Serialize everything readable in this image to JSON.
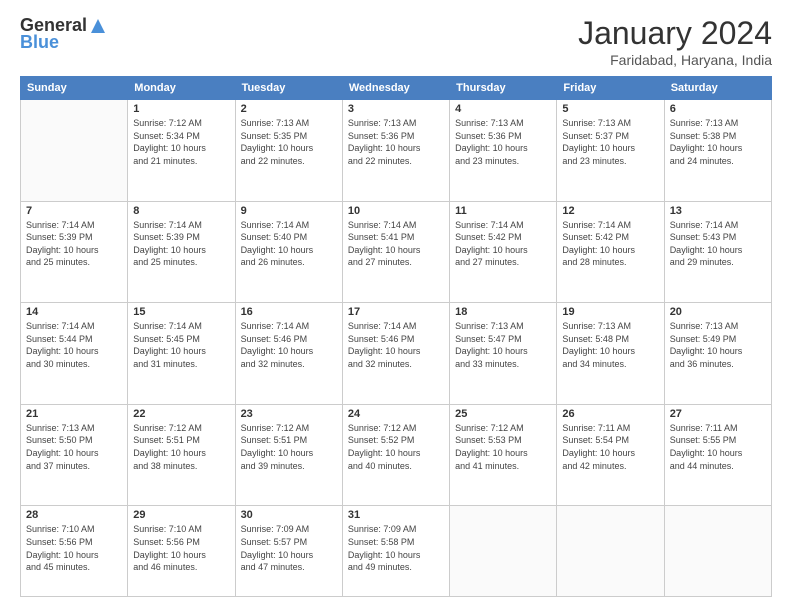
{
  "logo": {
    "line1": "General",
    "line2": "Blue"
  },
  "title": "January 2024",
  "location": "Faridabad, Haryana, India",
  "days_of_week": [
    "Sunday",
    "Monday",
    "Tuesday",
    "Wednesday",
    "Thursday",
    "Friday",
    "Saturday"
  ],
  "weeks": [
    [
      {
        "day": "",
        "sunrise": "",
        "sunset": "",
        "daylight": ""
      },
      {
        "day": "1",
        "sunrise": "Sunrise: 7:12 AM",
        "sunset": "Sunset: 5:34 PM",
        "daylight": "Daylight: 10 hours and 21 minutes."
      },
      {
        "day": "2",
        "sunrise": "Sunrise: 7:13 AM",
        "sunset": "Sunset: 5:35 PM",
        "daylight": "Daylight: 10 hours and 22 minutes."
      },
      {
        "day": "3",
        "sunrise": "Sunrise: 7:13 AM",
        "sunset": "Sunset: 5:36 PM",
        "daylight": "Daylight: 10 hours and 22 minutes."
      },
      {
        "day": "4",
        "sunrise": "Sunrise: 7:13 AM",
        "sunset": "Sunset: 5:36 PM",
        "daylight": "Daylight: 10 hours and 23 minutes."
      },
      {
        "day": "5",
        "sunrise": "Sunrise: 7:13 AM",
        "sunset": "Sunset: 5:37 PM",
        "daylight": "Daylight: 10 hours and 23 minutes."
      },
      {
        "day": "6",
        "sunrise": "Sunrise: 7:13 AM",
        "sunset": "Sunset: 5:38 PM",
        "daylight": "Daylight: 10 hours and 24 minutes."
      }
    ],
    [
      {
        "day": "7",
        "sunrise": "Sunrise: 7:14 AM",
        "sunset": "Sunset: 5:39 PM",
        "daylight": "Daylight: 10 hours and 25 minutes."
      },
      {
        "day": "8",
        "sunrise": "Sunrise: 7:14 AM",
        "sunset": "Sunset: 5:39 PM",
        "daylight": "Daylight: 10 hours and 25 minutes."
      },
      {
        "day": "9",
        "sunrise": "Sunrise: 7:14 AM",
        "sunset": "Sunset: 5:40 PM",
        "daylight": "Daylight: 10 hours and 26 minutes."
      },
      {
        "day": "10",
        "sunrise": "Sunrise: 7:14 AM",
        "sunset": "Sunset: 5:41 PM",
        "daylight": "Daylight: 10 hours and 27 minutes."
      },
      {
        "day": "11",
        "sunrise": "Sunrise: 7:14 AM",
        "sunset": "Sunset: 5:42 PM",
        "daylight": "Daylight: 10 hours and 27 minutes."
      },
      {
        "day": "12",
        "sunrise": "Sunrise: 7:14 AM",
        "sunset": "Sunset: 5:42 PM",
        "daylight": "Daylight: 10 hours and 28 minutes."
      },
      {
        "day": "13",
        "sunrise": "Sunrise: 7:14 AM",
        "sunset": "Sunset: 5:43 PM",
        "daylight": "Daylight: 10 hours and 29 minutes."
      }
    ],
    [
      {
        "day": "14",
        "sunrise": "Sunrise: 7:14 AM",
        "sunset": "Sunset: 5:44 PM",
        "daylight": "Daylight: 10 hours and 30 minutes."
      },
      {
        "day": "15",
        "sunrise": "Sunrise: 7:14 AM",
        "sunset": "Sunset: 5:45 PM",
        "daylight": "Daylight: 10 hours and 31 minutes."
      },
      {
        "day": "16",
        "sunrise": "Sunrise: 7:14 AM",
        "sunset": "Sunset: 5:46 PM",
        "daylight": "Daylight: 10 hours and 32 minutes."
      },
      {
        "day": "17",
        "sunrise": "Sunrise: 7:14 AM",
        "sunset": "Sunset: 5:46 PM",
        "daylight": "Daylight: 10 hours and 32 minutes."
      },
      {
        "day": "18",
        "sunrise": "Sunrise: 7:13 AM",
        "sunset": "Sunset: 5:47 PM",
        "daylight": "Daylight: 10 hours and 33 minutes."
      },
      {
        "day": "19",
        "sunrise": "Sunrise: 7:13 AM",
        "sunset": "Sunset: 5:48 PM",
        "daylight": "Daylight: 10 hours and 34 minutes."
      },
      {
        "day": "20",
        "sunrise": "Sunrise: 7:13 AM",
        "sunset": "Sunset: 5:49 PM",
        "daylight": "Daylight: 10 hours and 36 minutes."
      }
    ],
    [
      {
        "day": "21",
        "sunrise": "Sunrise: 7:13 AM",
        "sunset": "Sunset: 5:50 PM",
        "daylight": "Daylight: 10 hours and 37 minutes."
      },
      {
        "day": "22",
        "sunrise": "Sunrise: 7:12 AM",
        "sunset": "Sunset: 5:51 PM",
        "daylight": "Daylight: 10 hours and 38 minutes."
      },
      {
        "day": "23",
        "sunrise": "Sunrise: 7:12 AM",
        "sunset": "Sunset: 5:51 PM",
        "daylight": "Daylight: 10 hours and 39 minutes."
      },
      {
        "day": "24",
        "sunrise": "Sunrise: 7:12 AM",
        "sunset": "Sunset: 5:52 PM",
        "daylight": "Daylight: 10 hours and 40 minutes."
      },
      {
        "day": "25",
        "sunrise": "Sunrise: 7:12 AM",
        "sunset": "Sunset: 5:53 PM",
        "daylight": "Daylight: 10 hours and 41 minutes."
      },
      {
        "day": "26",
        "sunrise": "Sunrise: 7:11 AM",
        "sunset": "Sunset: 5:54 PM",
        "daylight": "Daylight: 10 hours and 42 minutes."
      },
      {
        "day": "27",
        "sunrise": "Sunrise: 7:11 AM",
        "sunset": "Sunset: 5:55 PM",
        "daylight": "Daylight: 10 hours and 44 minutes."
      }
    ],
    [
      {
        "day": "28",
        "sunrise": "Sunrise: 7:10 AM",
        "sunset": "Sunset: 5:56 PM",
        "daylight": "Daylight: 10 hours and 45 minutes."
      },
      {
        "day": "29",
        "sunrise": "Sunrise: 7:10 AM",
        "sunset": "Sunset: 5:56 PM",
        "daylight": "Daylight: 10 hours and 46 minutes."
      },
      {
        "day": "30",
        "sunrise": "Sunrise: 7:09 AM",
        "sunset": "Sunset: 5:57 PM",
        "daylight": "Daylight: 10 hours and 47 minutes."
      },
      {
        "day": "31",
        "sunrise": "Sunrise: 7:09 AM",
        "sunset": "Sunset: 5:58 PM",
        "daylight": "Daylight: 10 hours and 49 minutes."
      },
      {
        "day": "",
        "sunrise": "",
        "sunset": "",
        "daylight": ""
      },
      {
        "day": "",
        "sunrise": "",
        "sunset": "",
        "daylight": ""
      },
      {
        "day": "",
        "sunrise": "",
        "sunset": "",
        "daylight": ""
      }
    ]
  ]
}
